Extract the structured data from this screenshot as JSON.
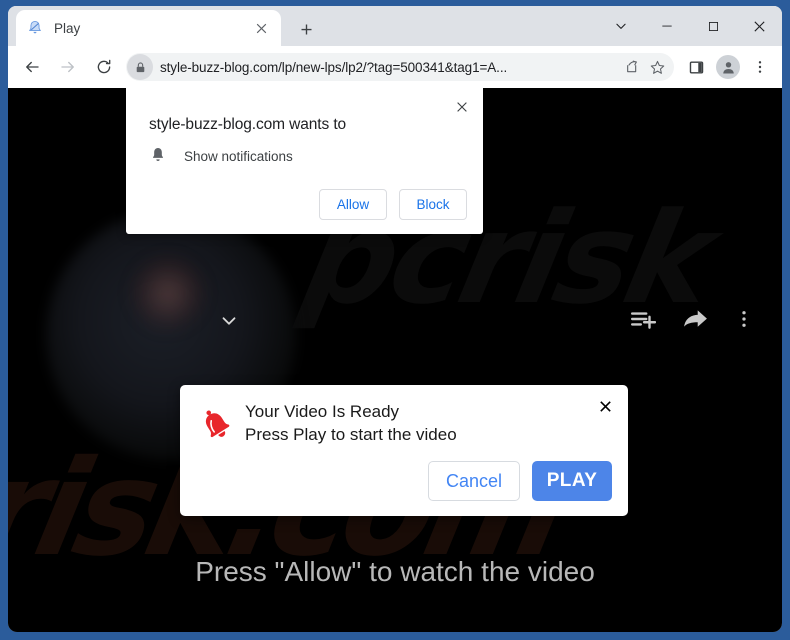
{
  "window": {
    "frame_color": "#2b5c9b",
    "controls": [
      {
        "name": "tab-search-button",
        "icon": "chevron-down-icon"
      },
      {
        "name": "minimize-button",
        "icon": "minimize-icon"
      },
      {
        "name": "maximize-button",
        "icon": "maximize-icon"
      },
      {
        "name": "close-button",
        "icon": "close-icon"
      }
    ]
  },
  "tabs": {
    "active": {
      "title": "Play",
      "favicon": "bell-icon"
    },
    "new_tab_label": "+"
  },
  "toolbar": {
    "back": "back-arrow-icon",
    "forward": "forward-arrow-icon",
    "reload": "reload-icon",
    "lock": "lock-icon",
    "url": "style-buzz-blog.com/lp/new-lps/lp2/?tag=500341&tag1=A...",
    "share": "share-icon",
    "bookmark": "star-icon",
    "side_panel": "side-panel-icon",
    "profile": "avatar-icon",
    "menu": "three-dot-menu-icon"
  },
  "permission_popup": {
    "title": "style-buzz-blog.com wants to",
    "permission_icon": "bell-icon",
    "permission_label": "Show notifications",
    "allow_label": "Allow",
    "block_label": "Block",
    "close_icon": "close-icon"
  },
  "video_dialog": {
    "icon": "red-bell-icon",
    "line1": "Your Video Is Ready",
    "line2": "Press Play to start the video",
    "cancel_label": "Cancel",
    "play_label": "PLAY",
    "play_color": "#4d85e8",
    "link_color": "#4285f4",
    "close_icon": "close-icon"
  },
  "page": {
    "hint_text": "Press \"Allow\" to watch the video",
    "watermark": "risk.com",
    "watermark_top": "pcrisk",
    "player_controls": [
      {
        "name": "add-to-playlist-icon"
      },
      {
        "name": "share-icon"
      },
      {
        "name": "more-options-icon"
      }
    ]
  }
}
